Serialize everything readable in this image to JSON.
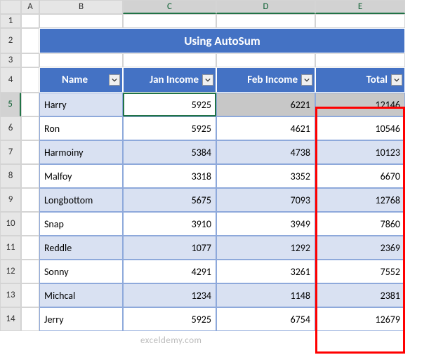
{
  "columns": [
    "A",
    "B",
    "C",
    "D",
    "E"
  ],
  "row_labels": [
    "1",
    "2",
    "3",
    "4",
    "5",
    "6",
    "7",
    "8",
    "9",
    "10",
    "11",
    "12",
    "13",
    "14"
  ],
  "active_row": "5",
  "active_cols": [
    "C",
    "D",
    "E"
  ],
  "title": "Using AutoSum",
  "headers": {
    "name": "Name",
    "jan": "Jan Income",
    "feb": "Feb Income",
    "total": "Total"
  },
  "rows": [
    {
      "name": "Harry",
      "jan": "5925",
      "feb": "6221",
      "total": "12146"
    },
    {
      "name": "Ron",
      "jan": "5925",
      "feb": "4621",
      "total": "10546"
    },
    {
      "name": "Harmoiny",
      "jan": "5384",
      "feb": "4738",
      "total": "10123"
    },
    {
      "name": "Malfoy",
      "jan": "3318",
      "feb": "3352",
      "total": "6670"
    },
    {
      "name": "Longbottom",
      "jan": "5675",
      "feb": "7093",
      "total": "12768"
    },
    {
      "name": "Snap",
      "jan": "3910",
      "feb": "3949",
      "total": "7860"
    },
    {
      "name": "Reddle",
      "jan": "1077",
      "feb": "1292",
      "total": "2369"
    },
    {
      "name": "Sonny",
      "jan": "4291",
      "feb": "3261",
      "total": "7552"
    },
    {
      "name": "Michcal",
      "jan": "1234",
      "feb": "1148",
      "total": "2381"
    },
    {
      "name": "Jerry",
      "jan": "5925",
      "feb": "6754",
      "total": "12679"
    }
  ],
  "watermark": "exceldemy.com",
  "chart_data": {
    "type": "table",
    "title": "Using AutoSum",
    "columns": [
      "Name",
      "Jan Income",
      "Feb Income",
      "Total"
    ],
    "data": [
      [
        "Harry",
        5925,
        6221,
        12146
      ],
      [
        "Ron",
        5925,
        4621,
        10546
      ],
      [
        "Harmoiny",
        5384,
        4738,
        10123
      ],
      [
        "Malfoy",
        3318,
        3352,
        6670
      ],
      [
        "Longbottom",
        5675,
        7093,
        12768
      ],
      [
        "Snap",
        3910,
        3949,
        7860
      ],
      [
        "Reddle",
        1077,
        1292,
        2369
      ],
      [
        "Sonny",
        4291,
        3261,
        7552
      ],
      [
        "Michcal",
        1234,
        1148,
        2381
      ],
      [
        "Jerry",
        5925,
        6754,
        12679
      ]
    ]
  }
}
